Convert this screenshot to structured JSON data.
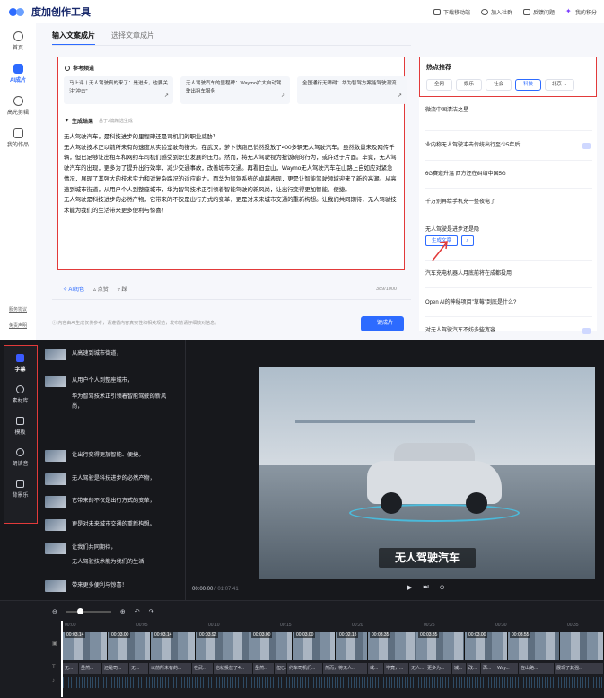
{
  "app": {
    "logo_text": "度加创作工具"
  },
  "topbar": {
    "links": [
      {
        "label": "下载移动端",
        "icon": "download-icon"
      },
      {
        "label": "加入社群",
        "icon": "chat-icon"
      },
      {
        "label": "反馈问题",
        "icon": "feedback-icon"
      },
      {
        "label": "我的积分",
        "icon": "points-icon"
      }
    ]
  },
  "leftnav": {
    "items": [
      {
        "label": "首页",
        "icon": "home-icon",
        "active": false
      },
      {
        "label": "AI成片",
        "icon": "ai-icon",
        "active": true
      },
      {
        "label": "高光剪辑",
        "icon": "clip-icon",
        "active": false
      },
      {
        "label": "我的作品",
        "icon": "works-icon",
        "active": false
      }
    ],
    "bottom_links": [
      "服务协议",
      "免责声明"
    ]
  },
  "tabs": [
    "输入文案成片",
    "选择文章成片"
  ],
  "reference": {
    "title": "参考频道",
    "cards": [
      "马上评丨无人驾驶真的来了：是进步，也要关注\"冲击\"",
      "无人驾驶汽车的里程碑：Waymo扩大自动驾驶出租车服务",
      "全国通行无障碍：华为智驾方案能驾驶潮流"
    ]
  },
  "generated": {
    "title": "生成结果",
    "subtitle": "基于3篇精选生成",
    "paragraphs": [
      "无人驾驶汽车，是科技进步的里程碑还是司机们的职业威胁？",
      "无人驾驶技术正以前所未有的速度从实验室驶向街头。在武汉，萝卜快跑已悄然投放了400多辆无人驾驶汽车。虽然数量未及网传千辆，但已足够让出租车和网约车司机们感受到职业发展的压力。然而，将无人驾驶视为抢饭碗的行为，或许过于片面。毕竟，无人驾驶汽车的出现，更多为了提升出行效率，减少交通事故，改善城市交通。再看旧金山，Waymo无人驾驶汽车在山路上自如应对紧急情况，展现了其强大的技术实力和对复杂路况的适应能力。而华为智驾系统的卓越表现，更是让智能驾驶领域迎来了新的高潮。从高速到城市街道，从用户个人到整座城市，华为智驾技术正引领着智能驾驶的新风尚，让出行变得更加智能、便捷。",
      "无人驾驶是科技进步的必然产物，它带来的不仅是出行方式的变革，更是对未来城市交通的重新构想。让我们共同期待，无人驾驶技术能为我们的生活带来更多便利与惊喜！"
    ]
  },
  "editor_footer": {
    "ai_polish": "AI润色",
    "like": "点赞",
    "dislike": "踩",
    "count": "389/1000"
  },
  "disclaimer": "内容由AI生成仅供参考，请遵循内容真实性和相关规范，发布前请仔细核对信息。",
  "generate_button": "一键成片",
  "hot": {
    "title": "热点推荐",
    "categories": [
      "全网",
      "娱乐",
      "社会",
      "科技",
      "北京"
    ],
    "active_category": "科技",
    "items": [
      {
        "text": "微流中国清洁之星",
        "tag": false
      },
      {
        "text": "业内称无人驾驶冲击传统出行至少5年后",
        "tag": true
      },
      {
        "text": "6G赛道升温 西方还在纠结中国5G",
        "tag": false
      },
      {
        "text": "千万别再给手机充一整夜电了",
        "tag": false
      },
      {
        "text": "无人驾驶是进步还是隐",
        "tag": false
      },
      {
        "text": "汽车充电机器人月底前将在成都投用",
        "tag": false
      },
      {
        "text": "Open AI的神秘项目\"草莓\"到底是什么?",
        "tag": false
      },
      {
        "text": "对无人驾驶汽车不妨多些宽容",
        "tag": true
      }
    ],
    "gen_label": "生成文章"
  },
  "video_sidebar": {
    "items": [
      {
        "label": "字幕",
        "icon": "subtitle-icon",
        "active": true
      },
      {
        "label": "素材库",
        "icon": "library-icon",
        "active": false
      },
      {
        "label": "模板",
        "icon": "template-icon",
        "active": false
      },
      {
        "label": "朗读音",
        "icon": "voice-icon",
        "active": false
      },
      {
        "label": "背景乐",
        "icon": "music-icon",
        "active": false
      }
    ]
  },
  "subtitles": [
    "从高速到城市街道，",
    "从用户个人到整座城市，",
    "华为智驾技术正引领着智能驾驶的新风尚，",
    "让出行变得更加智能、便捷。",
    "无人驾驶是科技进步的必然产物，",
    "它带来的不仅是出行方式的变革，",
    "更是对未来城市交通的重新构想。",
    "让我们共同期待，",
    "无人驾驶技术能为我们的生活",
    "带来更多便利与惊喜！"
  ],
  "video": {
    "caption": "无人驾驶汽车"
  },
  "player": {
    "current": "00:00.00",
    "total": "01:07.41"
  },
  "timeline": {
    "ruler": [
      "00:00",
      "00:05",
      "00:10",
      "00:15",
      "00:20",
      "00:25",
      "00:30",
      "00:35"
    ],
    "clips": [
      "00:03.14",
      "00:03.00",
      "00:03.14",
      "00:03.92",
      "00:03.00",
      "00:03.00",
      "00:02.13",
      "00:03.35",
      "00:03.35",
      "00:03.00",
      "00:03.55"
    ],
    "text_clips": [
      "无...",
      "虽然...",
      "还是司...",
      "无...",
      "以前所未有的...",
      "在武...",
      "也就投放了4...",
      "虽然...",
      "但已...",
      "约车司机们...",
      "然而，将无人...",
      "或...",
      "毕竟，...",
      "无人...",
      "更多为...",
      "减...",
      "改...",
      "再...",
      "Way...",
      "在山路...",
      "展现了其强..."
    ]
  }
}
